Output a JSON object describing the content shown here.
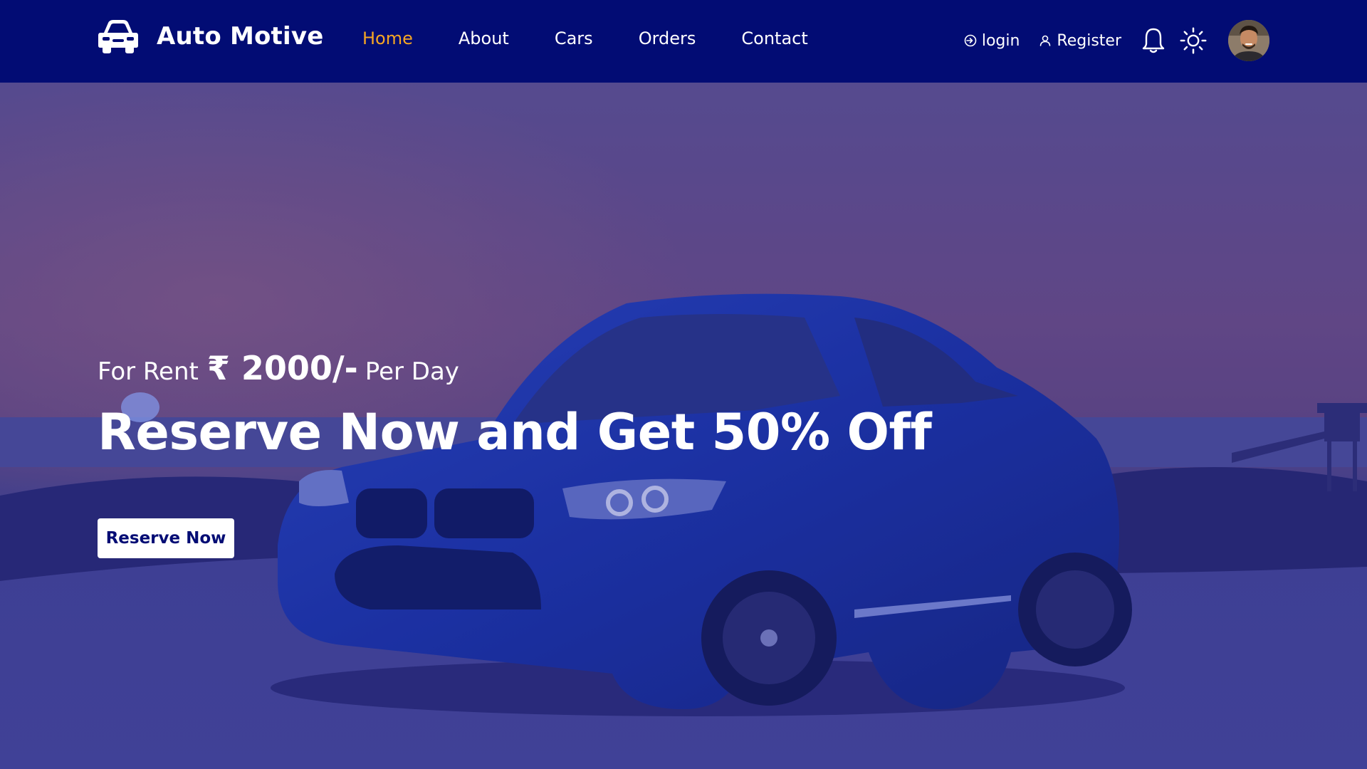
{
  "brand": {
    "name": "Auto Motive",
    "icon": "car-icon"
  },
  "nav": {
    "items": [
      {
        "label": "Home",
        "active": true
      },
      {
        "label": "About",
        "active": false
      },
      {
        "label": "Cars",
        "active": false
      },
      {
        "label": "Orders",
        "active": false
      },
      {
        "label": "Contact",
        "active": false
      }
    ],
    "active_color": "#f5a623"
  },
  "auth": {
    "login_label": "login",
    "login_icon": "login-icon",
    "register_label": "Register",
    "register_icon": "user-icon"
  },
  "toolbar": {
    "notification_icon": "bell-icon",
    "theme_icon": "sun-icon",
    "avatar": "avatar"
  },
  "hero": {
    "tagline_prefix": "For Rent",
    "price": "₹ 2000/-",
    "tagline_suffix": "Per Day",
    "headline": "Reserve Now and Get 50% Off",
    "cta_label": "Reserve Now",
    "background": "blue-coupe-on-beach-at-dusk"
  },
  "colors": {
    "nav_bg": "#020c74",
    "accent": "#f5a623",
    "overlay": "#1c1f8f"
  }
}
